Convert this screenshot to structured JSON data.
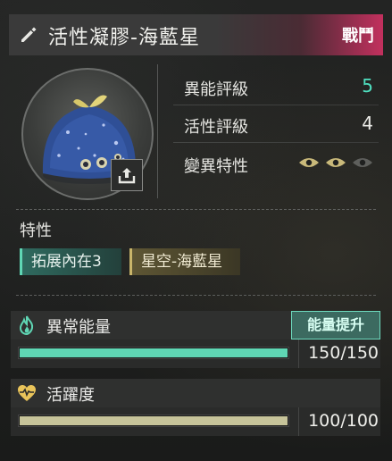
{
  "header": {
    "title": "活性凝膠-海藍星",
    "badge": "戰鬥",
    "edit_icon": "pencil-icon"
  },
  "portrait": {
    "export_icon": "share-export-icon"
  },
  "stats": [
    {
      "label": "異能評級",
      "value": "5",
      "value_color": "#4fe0c0"
    },
    {
      "label": "活性評級",
      "value": "4",
      "value_color": "#eaeae6"
    },
    {
      "label": "變異特性",
      "eyes_active": 2,
      "eyes_total": 3
    }
  ],
  "traits": {
    "title": "特性",
    "chips": [
      {
        "label": "拓展內在3"
      },
      {
        "label": "星空-海藍星"
      }
    ]
  },
  "energy": {
    "icon": "flame-icon",
    "label": "異常能量",
    "button": "能量提升",
    "current": 150,
    "max": 150,
    "text": "150/150",
    "color": "#5fd6b4"
  },
  "vitality": {
    "icon": "heart-pulse-icon",
    "label": "活躍度",
    "current": 100,
    "max": 100,
    "text": "100/100",
    "color": "#c7c49a"
  }
}
